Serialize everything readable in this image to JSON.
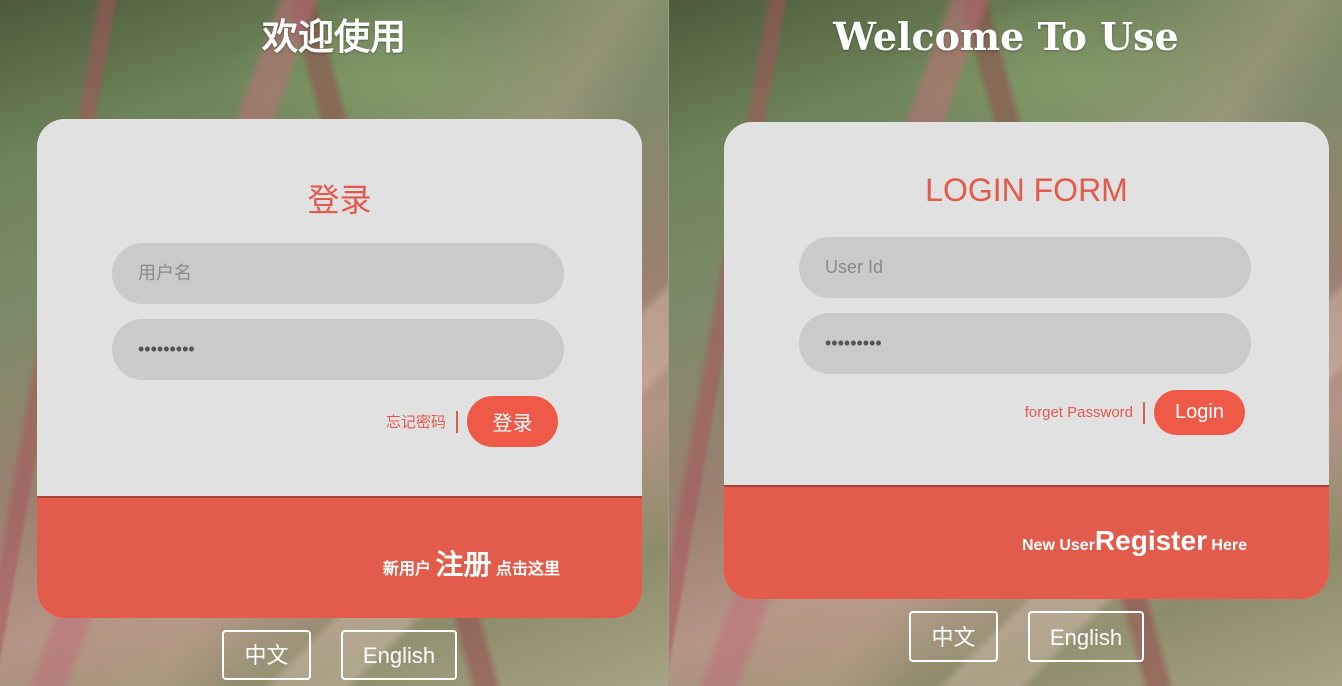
{
  "left": {
    "welcome": "欢迎使用",
    "form_title": "登录",
    "username_placeholder": "用户名",
    "password_value": "•••••••••",
    "forgot_label": "忘记密码",
    "login_button": "登录",
    "register_prefix": "新用户",
    "register_link": "注册",
    "register_suffix": "点击这里",
    "lang_zh": "中文",
    "lang_en": "English"
  },
  "right": {
    "welcome": "Welcome To Use",
    "form_title": "LOGIN FORM",
    "username_placeholder": "User Id",
    "password_value": "•••••••••",
    "forgot_label": "forget Password",
    "login_button": "Login",
    "register_prefix": "New User",
    "register_link": "Register",
    "register_suffix": "Here",
    "lang_zh": "中文",
    "lang_en": "English"
  },
  "colors": {
    "accent": "#e25a4a",
    "card_bg": "#e1e1e1",
    "input_bg": "#cacaca",
    "footer_bg": "#e35b4b"
  }
}
